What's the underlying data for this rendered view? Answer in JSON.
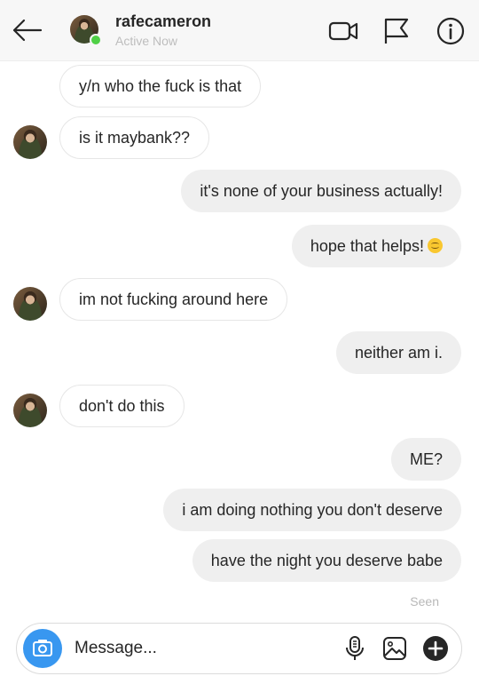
{
  "header": {
    "username": "rafecameron",
    "status": "Active Now",
    "icons": [
      "back-arrow-icon",
      "video-camera-icon",
      "flag-icon",
      "info-icon"
    ]
  },
  "messages": [
    {
      "direction": "incoming",
      "text": "y/n who the fuck is that",
      "avatar": false
    },
    {
      "direction": "incoming",
      "text": "is it maybank??",
      "avatar": true
    },
    {
      "direction": "outgoing",
      "text": "it's none of your business actually!"
    },
    {
      "direction": "outgoing",
      "text": "hope that helps!",
      "emoji": "smiling-face-emoji"
    },
    {
      "direction": "incoming",
      "text": "im not fucking around here",
      "avatar": true
    },
    {
      "direction": "outgoing",
      "text": "neither am i."
    },
    {
      "direction": "incoming",
      "text": "don't do this",
      "avatar": true
    },
    {
      "direction": "outgoing",
      "text": "ME?"
    },
    {
      "direction": "outgoing",
      "text": "i am doing nothing you don't deserve"
    },
    {
      "direction": "outgoing",
      "text": "have the night you deserve babe"
    }
  ],
  "seen_label": "Seen",
  "composer": {
    "placeholder": "Message...",
    "icons": [
      "camera-icon",
      "microphone-icon",
      "image-icon",
      "plus-icon"
    ]
  },
  "colors": {
    "accent": "#3897f0",
    "online": "#4fd046",
    "outgoing_bubble": "#efefef",
    "header_bg": "#f7f7f7"
  }
}
